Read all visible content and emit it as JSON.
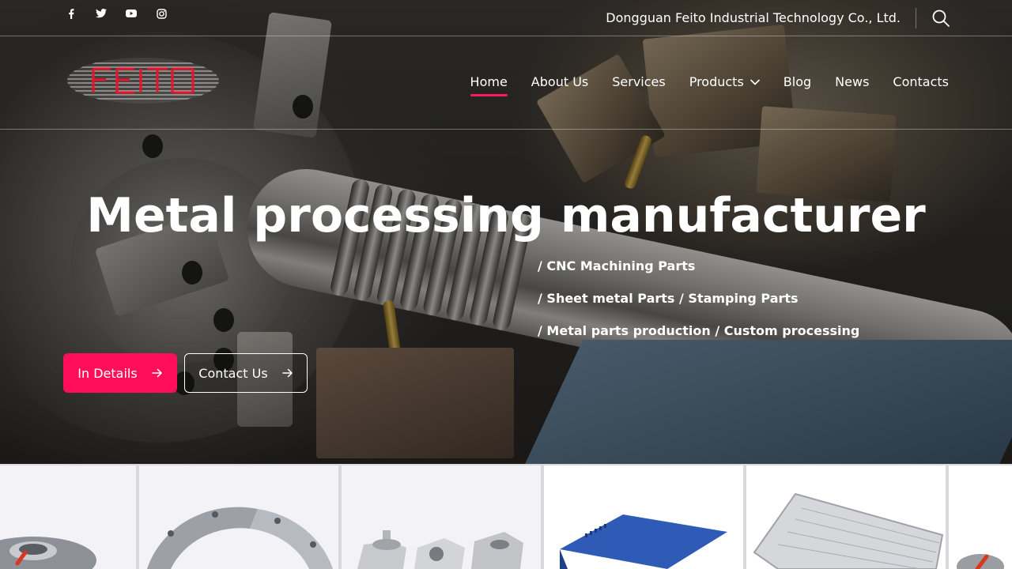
{
  "top_bar": {
    "social": [
      {
        "icon": "facebook-icon"
      },
      {
        "icon": "twitter-icon"
      },
      {
        "icon": "youtube-icon"
      },
      {
        "icon": "instagram-icon"
      }
    ],
    "company_name": "Dongguan Feito Industrial Technology Co., Ltd.",
    "search_icon": "search-icon"
  },
  "header": {
    "logo_text": "FEITO",
    "nav": [
      {
        "label": "Home",
        "active": true
      },
      {
        "label": "About Us"
      },
      {
        "label": "Services"
      },
      {
        "label": "Products",
        "has_dropdown": true
      },
      {
        "label": "Blog"
      },
      {
        "label": "News"
      },
      {
        "label": "Contacts"
      }
    ]
  },
  "hero": {
    "headline": "Metal processing manufacturer",
    "taglines": [
      "/ CNC Machining Parts",
      "/ Sheet metal Parts / Stamping Parts",
      "/ Metal parts production / Custom processing"
    ],
    "primary_button": "In Details",
    "secondary_button": "Contact Us"
  },
  "colors": {
    "accent": "#ff0f5b",
    "text": "#ffffff",
    "logo_red": "#e3162d"
  },
  "products": [
    {
      "icon": "flange-bearing-icon"
    },
    {
      "icon": "ring-segment-icon"
    },
    {
      "icon": "threaded-blocks-icon"
    },
    {
      "icon": "blue-enclosure-icon"
    },
    {
      "icon": "perforated-tray-icon"
    },
    {
      "icon": "partial-part-icon"
    }
  ]
}
